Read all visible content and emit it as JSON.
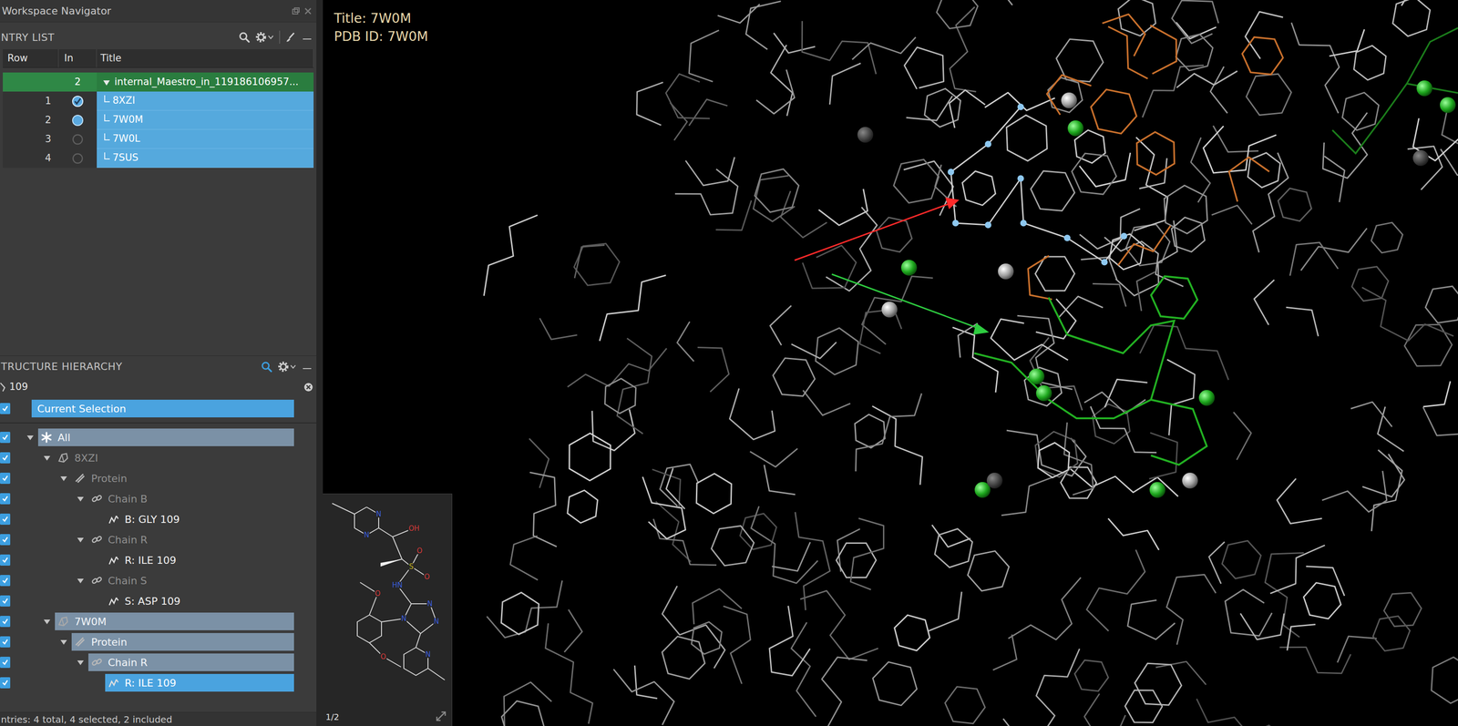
{
  "navigator": {
    "title": "Workspace Navigator"
  },
  "entry_list": {
    "title": "NTRY LIST",
    "columns": [
      "Row",
      "In",
      "Title"
    ],
    "group": {
      "count": "2",
      "title": "internal_Maestro_in_119186106957...",
      "expanded": true,
      "selected": true
    },
    "rows": [
      {
        "row": "1",
        "title": "8XZI",
        "included": true,
        "fixed": true,
        "selected": true
      },
      {
        "row": "2",
        "title": "7W0M",
        "included": true,
        "fixed": false,
        "selected": true
      },
      {
        "row": "3",
        "title": "7W0L",
        "included": false,
        "fixed": false,
        "selected": true
      },
      {
        "row": "4",
        "title": "7SUS",
        "included": false,
        "fixed": false,
        "selected": true
      }
    ]
  },
  "hierarchy": {
    "title": "TRUCTURE HIERARCHY",
    "filter": "109",
    "current_selection": {
      "label": "Current Selection",
      "checked": true,
      "selected": true
    },
    "nodes": [
      {
        "label": "All",
        "kind": "all",
        "depth": 0,
        "expanded": true,
        "checked": true,
        "dimmed": true,
        "partially_selected": true,
        "selected": false
      },
      {
        "label": "8XZI",
        "kind": "entry",
        "depth": 1,
        "expanded": true,
        "checked": true,
        "dimmed": true,
        "partially_selected": false,
        "selected": false
      },
      {
        "label": "Protein",
        "kind": "protein",
        "depth": 2,
        "expanded": true,
        "checked": true,
        "dimmed": true,
        "partially_selected": false,
        "selected": false
      },
      {
        "label": "Chain B",
        "kind": "chain",
        "depth": 3,
        "expanded": true,
        "checked": true,
        "dimmed": true,
        "partially_selected": false,
        "selected": false
      },
      {
        "label": "B: GLY 109",
        "kind": "residue",
        "depth": 4,
        "checked": true,
        "dimmed": false,
        "partially_selected": false,
        "selected": false
      },
      {
        "label": "Chain R",
        "kind": "chain",
        "depth": 3,
        "expanded": true,
        "checked": true,
        "dimmed": true,
        "partially_selected": false,
        "selected": false
      },
      {
        "label": "R: ILE 109",
        "kind": "residue",
        "depth": 4,
        "checked": true,
        "dimmed": false,
        "partially_selected": false,
        "selected": false
      },
      {
        "label": "Chain S",
        "kind": "chain",
        "depth": 3,
        "expanded": true,
        "checked": true,
        "dimmed": true,
        "partially_selected": false,
        "selected": false
      },
      {
        "label": "S: ASP 109",
        "kind": "residue",
        "depth": 4,
        "checked": true,
        "dimmed": false,
        "partially_selected": false,
        "selected": false
      },
      {
        "label": "7W0M",
        "kind": "entry",
        "depth": 1,
        "expanded": true,
        "checked": true,
        "dimmed": true,
        "partially_selected": true,
        "selected": false
      },
      {
        "label": "Protein",
        "kind": "protein",
        "depth": 2,
        "expanded": true,
        "checked": true,
        "dimmed": true,
        "partially_selected": true,
        "selected": false
      },
      {
        "label": "Chain R",
        "kind": "chain",
        "depth": 3,
        "expanded": true,
        "checked": true,
        "dimmed": true,
        "partially_selected": true,
        "selected": false
      },
      {
        "label": "R: ILE 109",
        "kind": "residue",
        "depth": 4,
        "checked": true,
        "dimmed": false,
        "partially_selected": false,
        "selected": true
      }
    ]
  },
  "status_bar": "ntries: 4 total, 4 selected, 2 included",
  "viewer": {
    "title": "Title: 7W0M",
    "pdb_id": "PDB ID: 7W0M"
  },
  "inset": {
    "page": "1/2",
    "atoms": [
      {
        "label": "N",
        "color": "#3a5cd8"
      },
      {
        "label": "N",
        "color": "#3a5cd8"
      },
      {
        "label": "OH",
        "color": "#d83a3a"
      },
      {
        "label": "S",
        "color": "#c8b820"
      },
      {
        "label": "O",
        "color": "#d83a3a"
      },
      {
        "label": "O",
        "color": "#d83a3a"
      },
      {
        "label": "HN",
        "color": "#3a5cd8"
      },
      {
        "label": "N",
        "color": "#3a5cd8"
      },
      {
        "label": "N",
        "color": "#3a5cd8"
      },
      {
        "label": "N",
        "color": "#3a5cd8"
      },
      {
        "label": "O",
        "color": "#d83a3a"
      },
      {
        "label": "O",
        "color": "#d83a3a"
      },
      {
        "label": "N",
        "color": "#3a5cd8"
      }
    ]
  }
}
